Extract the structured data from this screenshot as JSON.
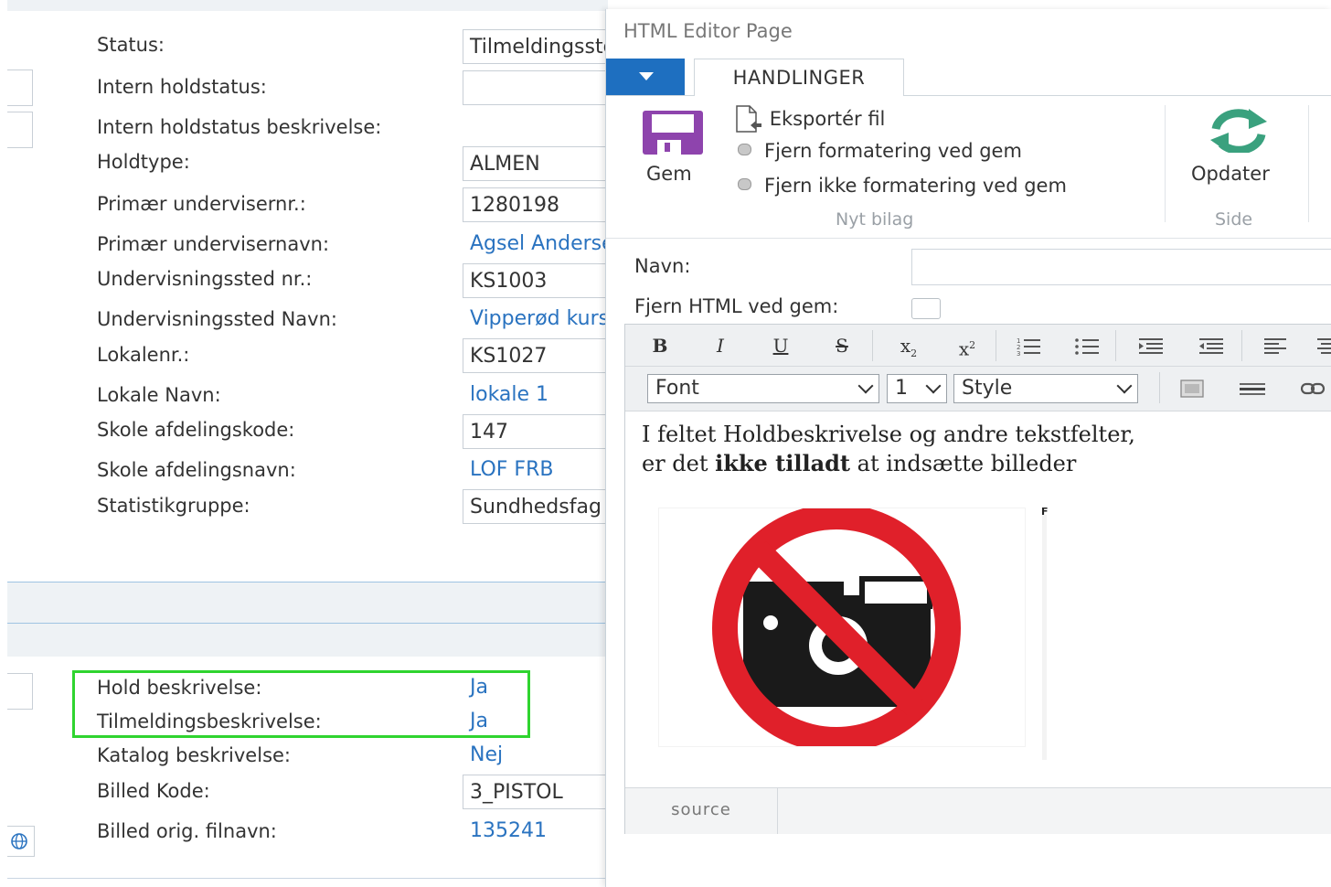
{
  "form": {
    "fields": [
      {
        "label": "Status:",
        "value": "Tilmeldingsstop"
      },
      {
        "label": "Intern holdstatus:",
        "value": ""
      },
      {
        "label": "Intern holdstatus beskrivelse:",
        "value": ""
      },
      {
        "label": "Holdtype:",
        "value": "ALMEN"
      },
      {
        "label": "Primær undervisernr.:",
        "value": "1280198"
      },
      {
        "label": "Primær undervisernavn:",
        "value": "Agsel Andersen"
      },
      {
        "label": "Undervisningssted nr.:",
        "value": "KS1003"
      },
      {
        "label": "Undervisningssted Navn:",
        "value": "Vipperød kursus"
      },
      {
        "label": "Lokalenr.:",
        "value": "KS1027"
      },
      {
        "label": "Lokale Navn:",
        "value": "lokale 1"
      },
      {
        "label": "Skole afdelingskode:",
        "value": "147"
      },
      {
        "label": "Skole afdelingsnavn:",
        "value": "LOF FRB"
      },
      {
        "label": "Statistikgruppe:",
        "value": "Sundhedsfag"
      }
    ],
    "lower_fields": [
      {
        "label": "Hold beskrivelse:",
        "value": "Ja"
      },
      {
        "label": "Tilmeldingsbeskrivelse:",
        "value": "Ja"
      },
      {
        "label": "Katalog beskrivelse:",
        "value": "Nej"
      },
      {
        "label": "Billed Kode:",
        "value": "3_PISTOL"
      },
      {
        "label": "Billed orig. filnavn:",
        "value": "135241"
      }
    ]
  },
  "dialog": {
    "title": "HTML Editor Page",
    "tab": "HANDLINGER",
    "ribbon": {
      "save_label": "Gem",
      "export_label": "Eksportér fil",
      "option_1": "Fjern formatering ved gem",
      "option_2": "Fjern ikke formatering ved gem",
      "group_1_label": "Nyt bilag",
      "refresh_label": "Opdater",
      "group_2_label": "Side"
    },
    "name_label": "Navn:",
    "name_value": "",
    "strip_html_label": "Fjern HTML ved gem:",
    "editor": {
      "font_select": "Font",
      "size_select": "1",
      "style_select": "Style",
      "line1": "I feltet Holdbeskrivelse og andre tekstfelter,",
      "line2_a": "er det ",
      "line2_b": "ikke tilladt",
      "line2_c": " at indsætte billeder",
      "source_tab": "source",
      "marker": "F"
    },
    "colors": {
      "accent": "#1e6fc0",
      "link": "#2a73c0",
      "highlight": "#2fd42f",
      "save_icon": "#8e44ad",
      "refresh_icon": "#3aa17e",
      "no_sign": "#e0202a"
    }
  }
}
